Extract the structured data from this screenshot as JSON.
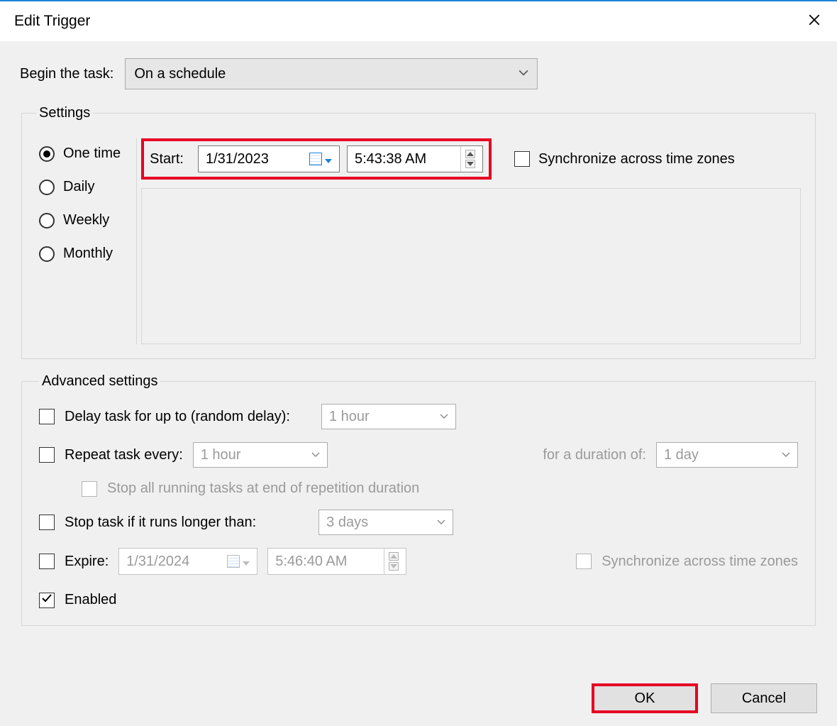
{
  "window": {
    "title": "Edit Trigger"
  },
  "begin": {
    "label": "Begin the task:",
    "value": "On a schedule"
  },
  "settings": {
    "legend": "Settings",
    "frequency": {
      "options": [
        "One time",
        "Daily",
        "Weekly",
        "Monthly"
      ],
      "selected": "One time"
    },
    "start": {
      "label": "Start:",
      "date": "1/31/2023",
      "time": "5:43:38 AM",
      "sync_label": "Synchronize across time zones",
      "sync_checked": false
    }
  },
  "advanced": {
    "legend": "Advanced settings",
    "delay": {
      "label": "Delay task for up to (random delay):",
      "value": "1 hour",
      "checked": false
    },
    "repeat": {
      "label": "Repeat task every:",
      "value": "1 hour",
      "duration_label": "for a duration of:",
      "duration_value": "1 day",
      "checked": false
    },
    "stop_repetition": {
      "label": "Stop all running tasks at end of repetition duration",
      "checked": false
    },
    "stop_if": {
      "label": "Stop task if it runs longer than:",
      "value": "3 days",
      "checked": false
    },
    "expire": {
      "label": "Expire:",
      "date": "1/31/2024",
      "time": "5:46:40 AM",
      "sync_label": "Synchronize across time zones",
      "checked": false
    },
    "enabled": {
      "label": "Enabled",
      "checked": true
    }
  },
  "buttons": {
    "ok": "OK",
    "cancel": "Cancel"
  }
}
